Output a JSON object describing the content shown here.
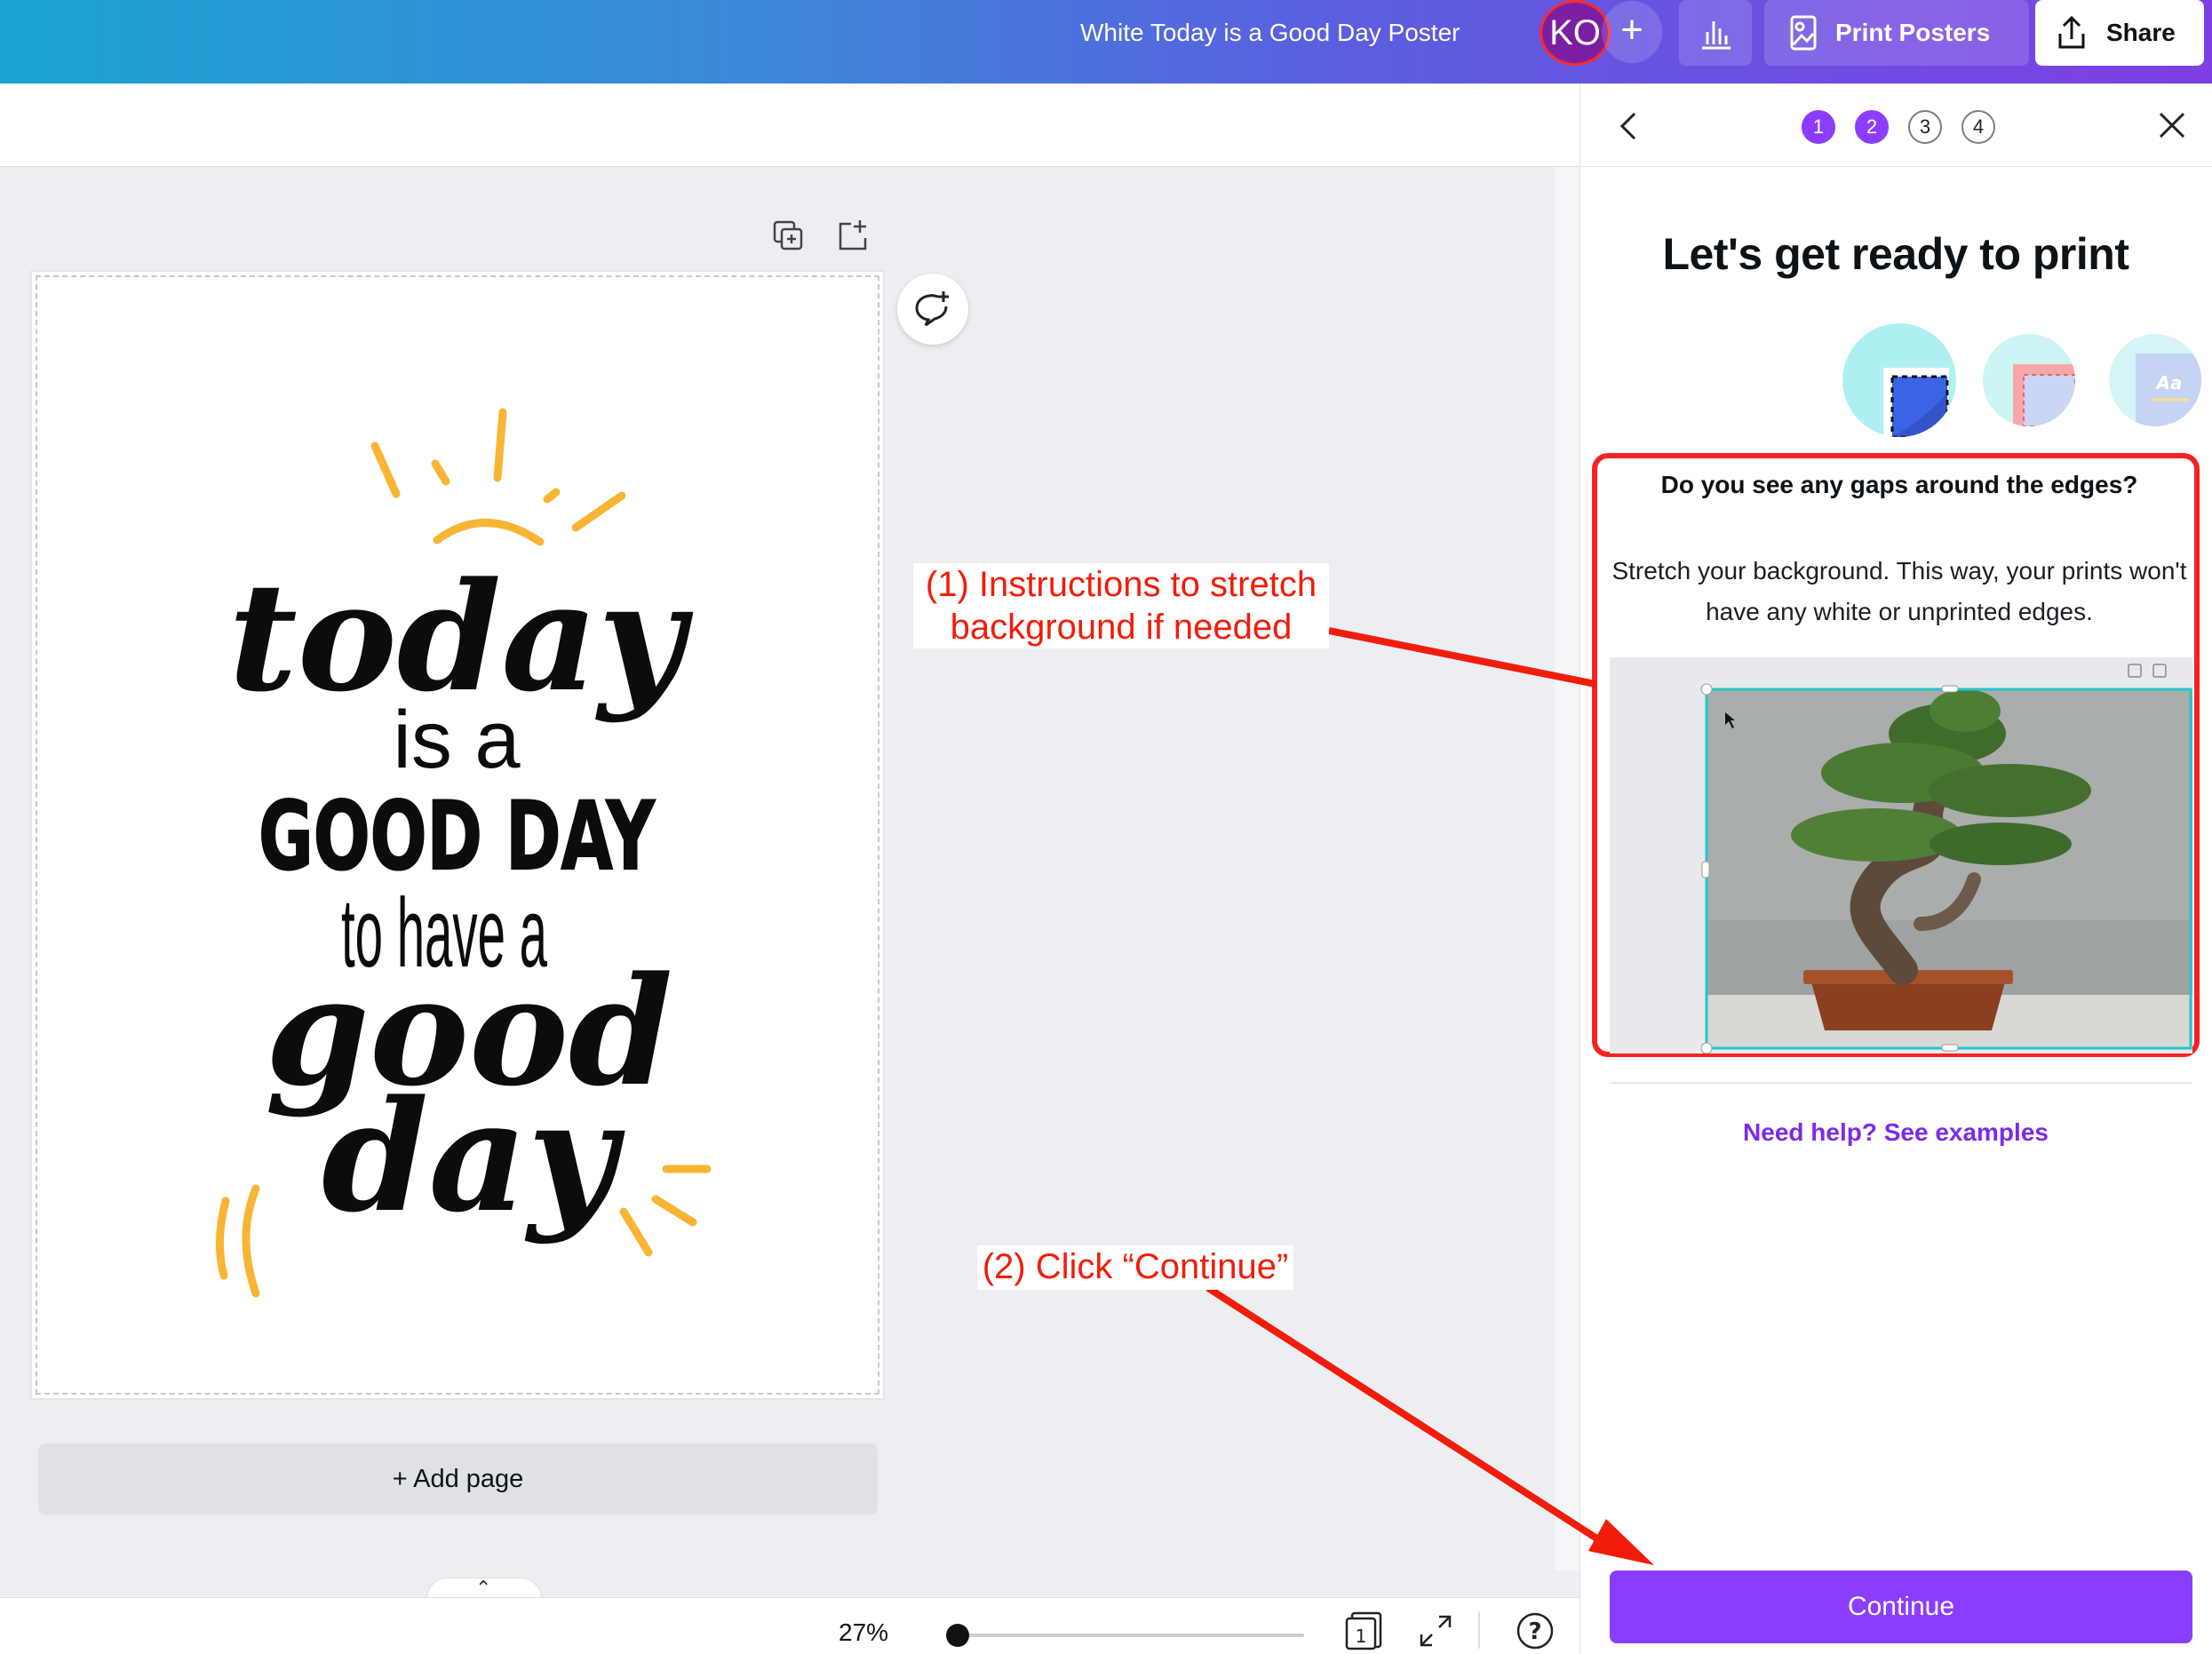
{
  "topbar": {
    "doc_title": "White Today is a Good Day Poster",
    "avatar_initials": "KO",
    "add_label": "+",
    "print_label": "Print Posters",
    "share_label": "Share"
  },
  "canvas": {
    "add_page_label": "+ Add page",
    "poster": {
      "line1": "today",
      "line2": "is a",
      "line3": "GOOD DAY",
      "line4": "to have a",
      "line5": "good",
      "line6": "day"
    }
  },
  "bottombar": {
    "zoom_label": "27%",
    "page_count": "1",
    "help_label": "?",
    "zoom_fraction": 0.27
  },
  "panel": {
    "steps": [
      "1",
      "2",
      "3",
      "4"
    ],
    "current_steps": 2,
    "title": "Let's get ready to print",
    "thumb_text": "Aa",
    "gap_heading": "Do you see any gaps around the edges?",
    "gap_text": "Stretch your background. This way, your prints won't have any white or unprinted edges.",
    "help_link": "Need help? See examples",
    "continue_label": "Continue"
  },
  "annotations": {
    "callout_1_line1": "(1) Instructions to stretch",
    "callout_1_line2": "background if needed",
    "callout_2": "(2) Click “Continue”"
  },
  "colors": {
    "accent": "#8b3dff",
    "annotation_red": "#f21c0a",
    "sun_orange": "#f8b534"
  }
}
